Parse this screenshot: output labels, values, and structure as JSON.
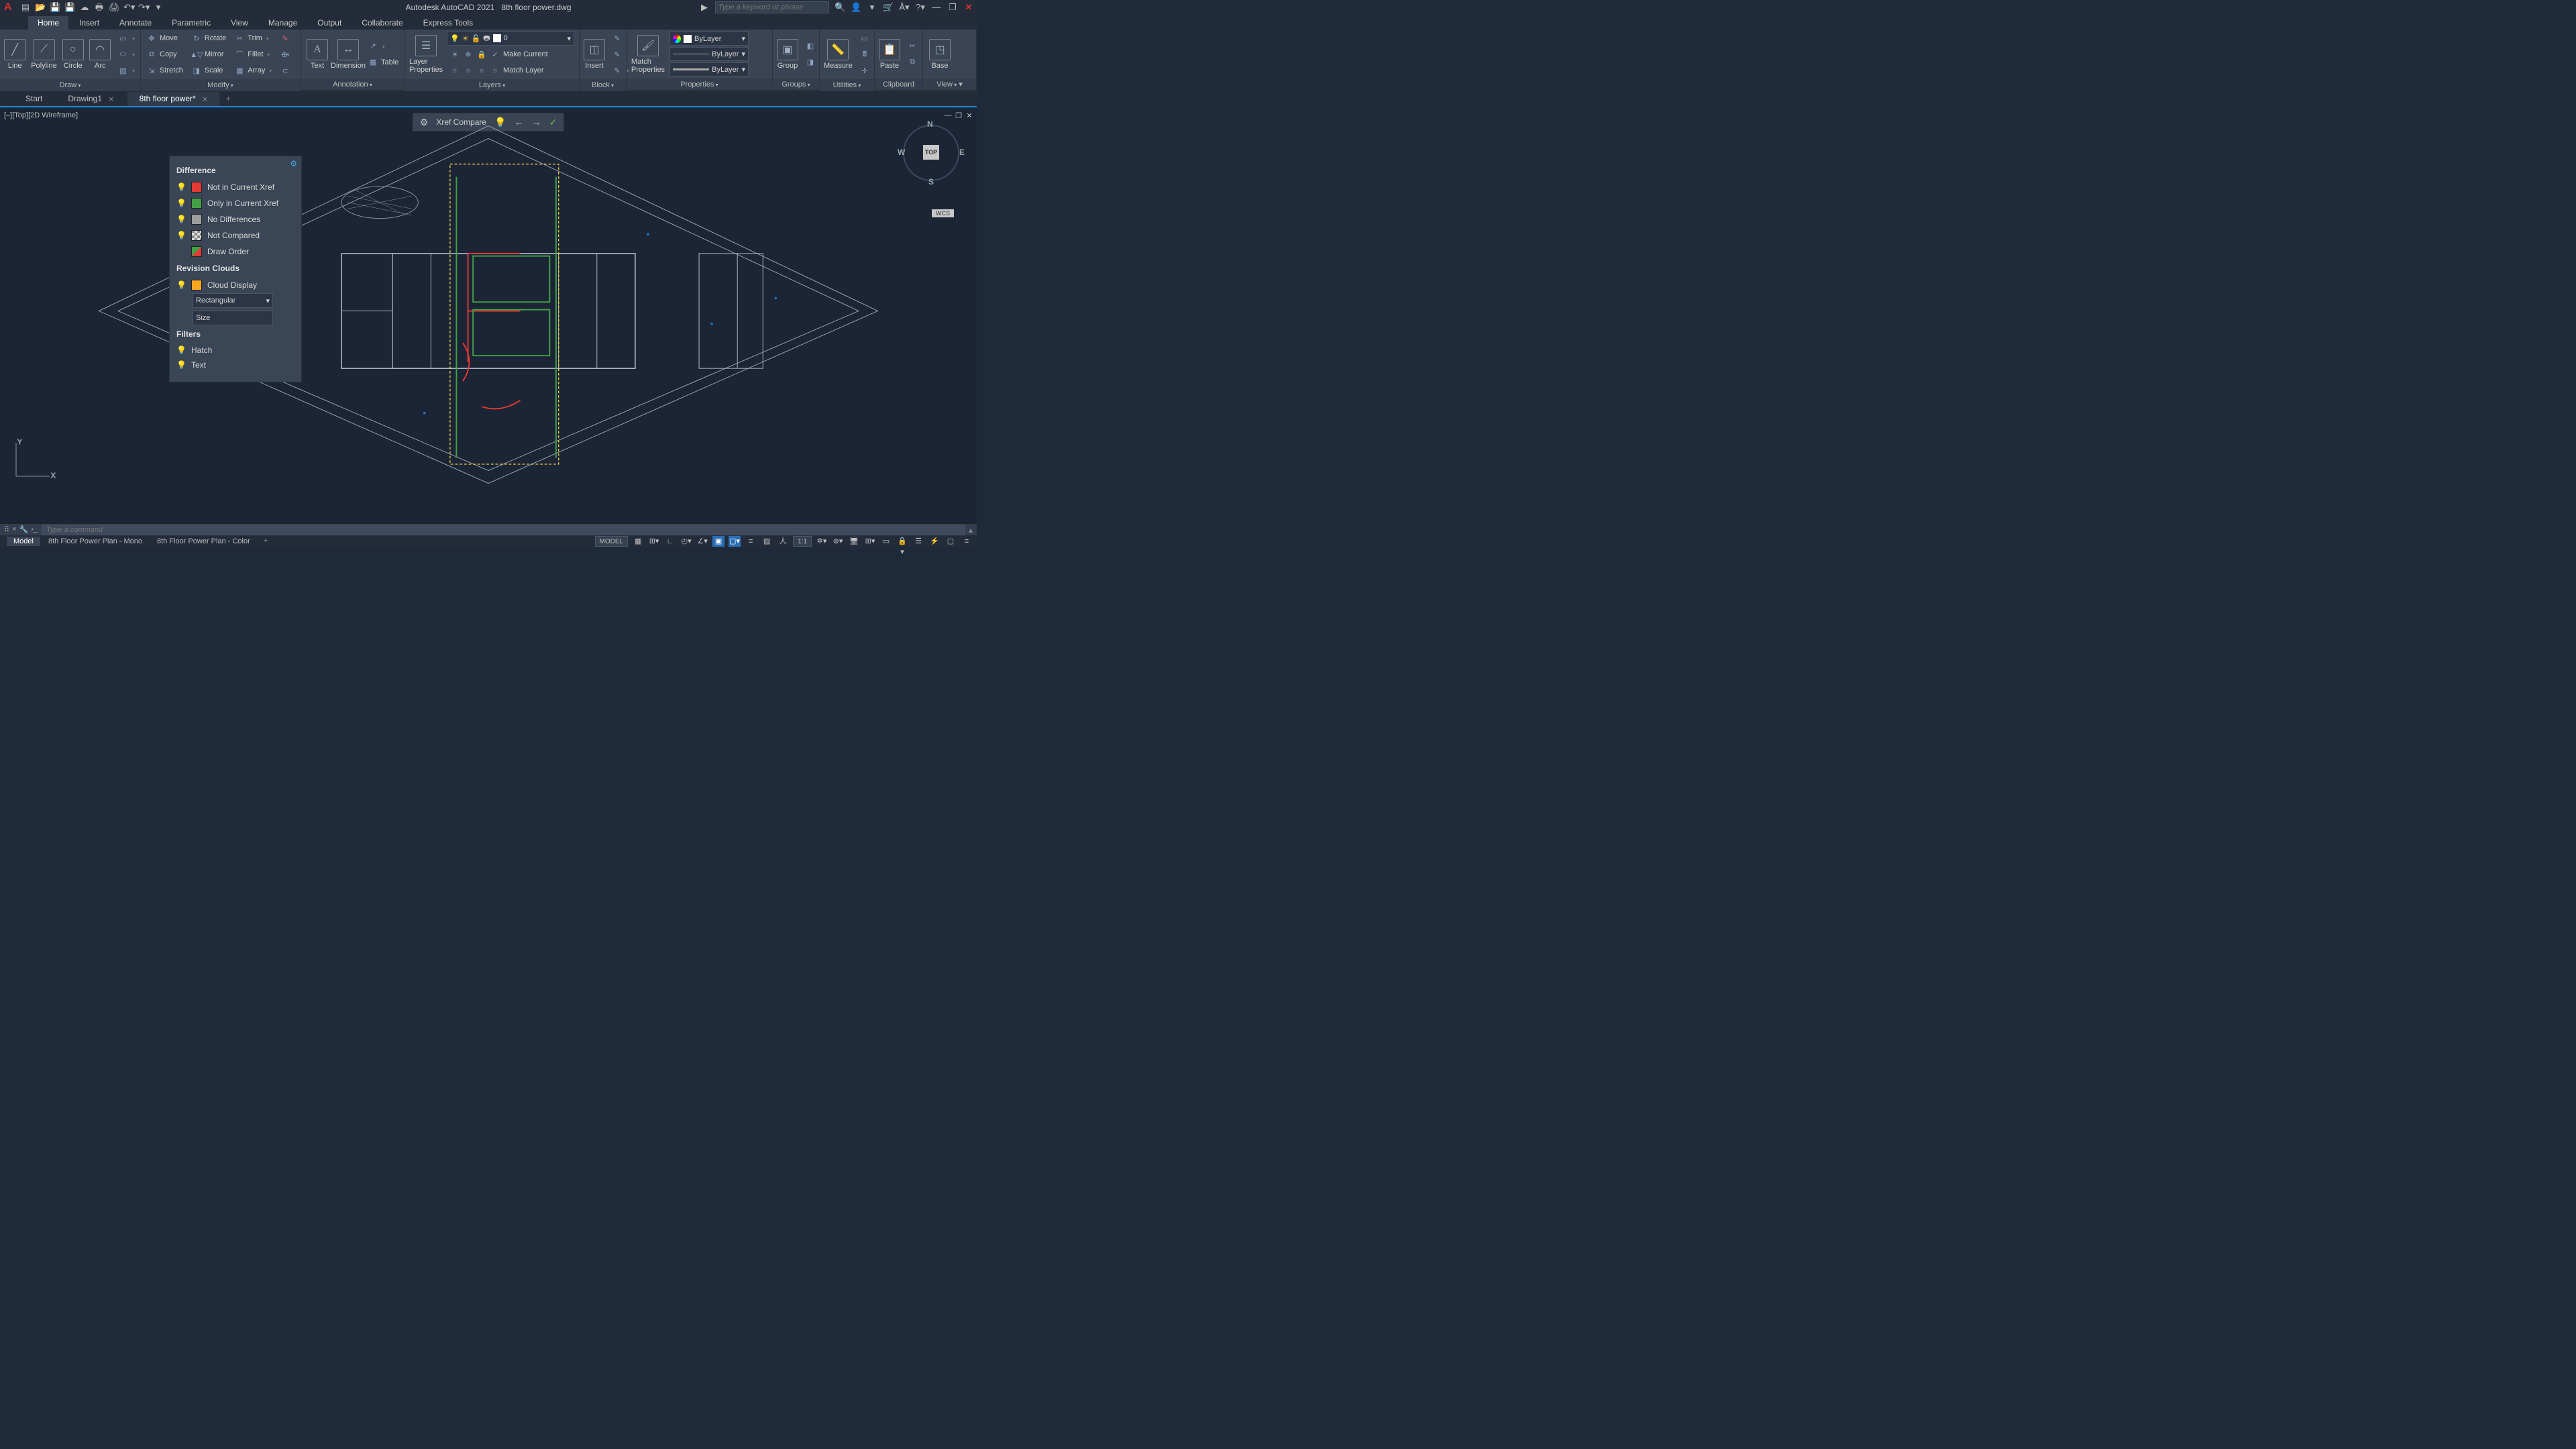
{
  "title": {
    "app": "Autodesk AutoCAD 2021",
    "file": "8th floor power.dwg"
  },
  "search": {
    "placeholder": "Type a keyword or phrase",
    "play": "▶"
  },
  "ribbon_tabs": [
    "Home",
    "Insert",
    "Annotate",
    "Parametric",
    "View",
    "Manage",
    "Output",
    "Collaborate",
    "Express Tools"
  ],
  "ribbon_active": "Home",
  "ribbon": {
    "draw": {
      "title": "Draw",
      "line": "Line",
      "polyline": "Polyline",
      "circle": "Circle",
      "arc": "Arc"
    },
    "modify": {
      "title": "Modify",
      "move": "Move",
      "rotate": "Rotate",
      "trim": "Trim",
      "copy": "Copy",
      "mirror": "Mirror",
      "fillet": "Fillet",
      "stretch": "Stretch",
      "scale": "Scale",
      "array": "Array"
    },
    "annotation": {
      "title": "Annotation",
      "text": "Text",
      "dimension": "Dimension",
      "table": "Table"
    },
    "layers": {
      "title": "Layers",
      "props": "Layer\nProperties",
      "current": "0",
      "make_current": "Make Current",
      "match_layer": "Match Layer"
    },
    "block": {
      "title": "Block",
      "insert": "Insert"
    },
    "properties": {
      "title": "Properties",
      "match": "Match\nProperties",
      "layer": "ByLayer",
      "ltype": "ByLayer",
      "lweight": "ByLayer"
    },
    "groups": {
      "title": "Groups",
      "group": "Group"
    },
    "utilities": {
      "title": "Utilities",
      "measure": "Measure"
    },
    "clipboard": {
      "title": "Clipboard",
      "paste": "Paste"
    },
    "view": {
      "title": "View",
      "base": "Base"
    }
  },
  "file_tabs": {
    "start": "Start",
    "drawing1": "Drawing1",
    "active": "8th floor power*"
  },
  "viewport_label": "[–][Top][2D Wireframe]",
  "viewcube": {
    "top": "TOP",
    "n": "N",
    "s": "S",
    "e": "E",
    "w": "W"
  },
  "wcs": "WCS",
  "xref": {
    "title": "Xref Compare",
    "gear": "⚙",
    "bulb": "💡",
    "prev": "←",
    "next": "→",
    "check": "✓"
  },
  "diff": {
    "h1": "Difference",
    "r1": "Not in Current Xref",
    "r2": "Only in Current Xref",
    "r3": "No Differences",
    "r4": "Not Compared",
    "r5": "Draw Order",
    "h2": "Revision Clouds",
    "cloud": "Cloud Display",
    "shape": "Rectangular",
    "size": "Size",
    "h3": "Filters",
    "hatch": "Hatch",
    "text": "Text"
  },
  "cmd": {
    "placeholder": "Type a command"
  },
  "layout_tabs": {
    "model": "Model",
    "l1": "8th Floor Power Plan - Mono",
    "l2": "8th Floor Power Plan - Color"
  },
  "status": {
    "model": "MODEL",
    "scale": "1:1"
  }
}
